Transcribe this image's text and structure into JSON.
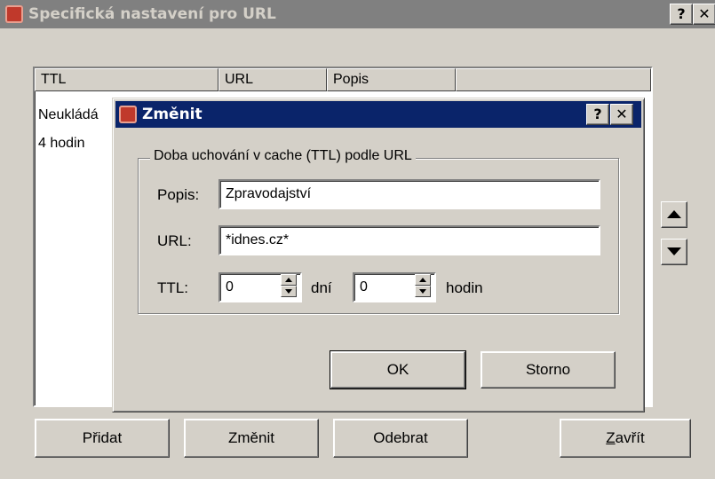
{
  "window": {
    "title": "Specifická nastavení pro URL",
    "help_label": "?",
    "close_label": "✕"
  },
  "table": {
    "columns": [
      "TTL",
      "URL",
      "Popis",
      ""
    ],
    "rows": [
      {
        "ttl": "Neukládá"
      },
      {
        "ttl": "4 hodin"
      }
    ]
  },
  "buttons": {
    "add": "Přidat",
    "edit": "Změnit",
    "remove": "Odebrat",
    "close_prefix": "Z",
    "close_rest": "avřít"
  },
  "dialog": {
    "title": "Změnit",
    "help_label": "?",
    "close_label": "✕",
    "group_label": "Doba uchování v cache (TTL) podle URL",
    "description_label": "Popis:",
    "description_value": "Zpravodajství",
    "url_label": "URL:",
    "url_value": "*idnes.cz*",
    "ttl_label": "TTL:",
    "days_value": "0",
    "days_unit": "dní",
    "hours_value": "0",
    "hours_unit": "hodin",
    "ok_label": "OK",
    "cancel_label": "Storno"
  },
  "colors": {
    "face": "#d4d0c8",
    "inactive_title": "#808080",
    "active_title": "#0a246a"
  }
}
